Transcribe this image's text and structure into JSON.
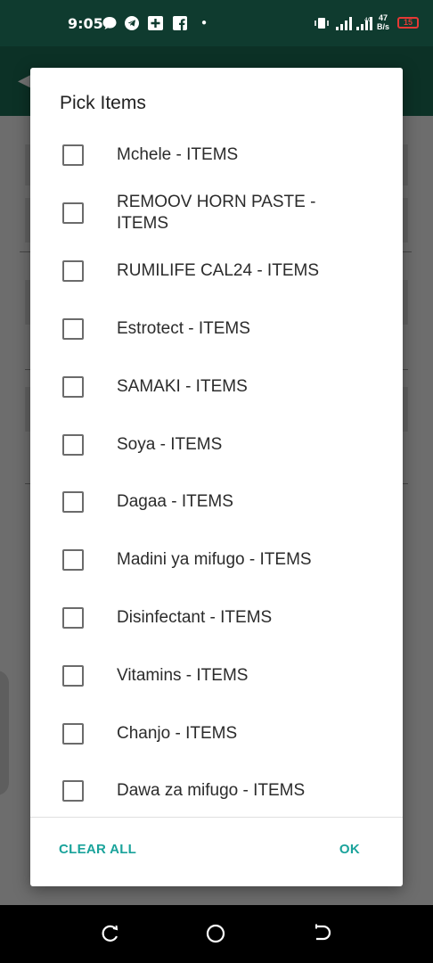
{
  "status_bar": {
    "time": "9:05",
    "network_speed_value": "47",
    "network_speed_unit": "B/s",
    "network_type": "4G",
    "battery": "15"
  },
  "dialog": {
    "title": "Pick Items",
    "items": [
      {
        "label": "Mchele - ITEMS",
        "checked": false
      },
      {
        "label": "REMOOV HORN PASTE - ITEMS",
        "checked": false
      },
      {
        "label": "RUMILIFE CAL24 - ITEMS",
        "checked": false
      },
      {
        "label": "Estrotect - ITEMS",
        "checked": false
      },
      {
        "label": "SAMAKI - ITEMS",
        "checked": false
      },
      {
        "label": "Soya - ITEMS",
        "checked": false
      },
      {
        "label": "Dagaa - ITEMS",
        "checked": false
      },
      {
        "label": "Madini ya mifugo - ITEMS",
        "checked": false
      },
      {
        "label": "Disinfectant - ITEMS",
        "checked": false
      },
      {
        "label": "Vitamins - ITEMS",
        "checked": false
      },
      {
        "label": "Chanjo - ITEMS",
        "checked": false
      },
      {
        "label": "Dawa za mifugo - ITEMS",
        "checked": false
      }
    ],
    "clear_all_label": "CLEAR ALL",
    "ok_label": "OK"
  },
  "colors": {
    "accent": "#1aa39b",
    "status_bar": "#0f3b2f",
    "toolbar": "#1b6e55"
  }
}
